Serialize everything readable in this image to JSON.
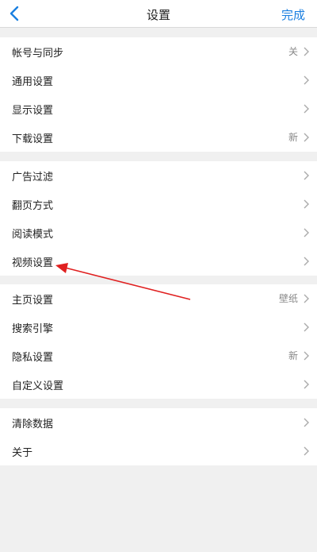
{
  "nav": {
    "title": "设置",
    "done_label": "完成"
  },
  "groups": [
    {
      "items": [
        {
          "label": "帐号与同步",
          "value": "关"
        },
        {
          "label": "通用设置",
          "value": ""
        },
        {
          "label": "显示设置",
          "value": ""
        },
        {
          "label": "下载设置",
          "value": "新"
        }
      ]
    },
    {
      "items": [
        {
          "label": "广告过滤",
          "value": ""
        },
        {
          "label": "翻页方式",
          "value": ""
        },
        {
          "label": "阅读模式",
          "value": ""
        },
        {
          "label": "视频设置",
          "value": ""
        }
      ]
    },
    {
      "items": [
        {
          "label": "主页设置",
          "value": "壁纸"
        },
        {
          "label": "搜索引擎",
          "value": ""
        },
        {
          "label": "隐私设置",
          "value": "新"
        },
        {
          "label": "自定义设置",
          "value": ""
        }
      ]
    },
    {
      "items": [
        {
          "label": "清除数据",
          "value": ""
        },
        {
          "label": "关于",
          "value": ""
        }
      ]
    }
  ],
  "colors": {
    "accent": "#1a7fe0",
    "annotation": "#e02020"
  }
}
